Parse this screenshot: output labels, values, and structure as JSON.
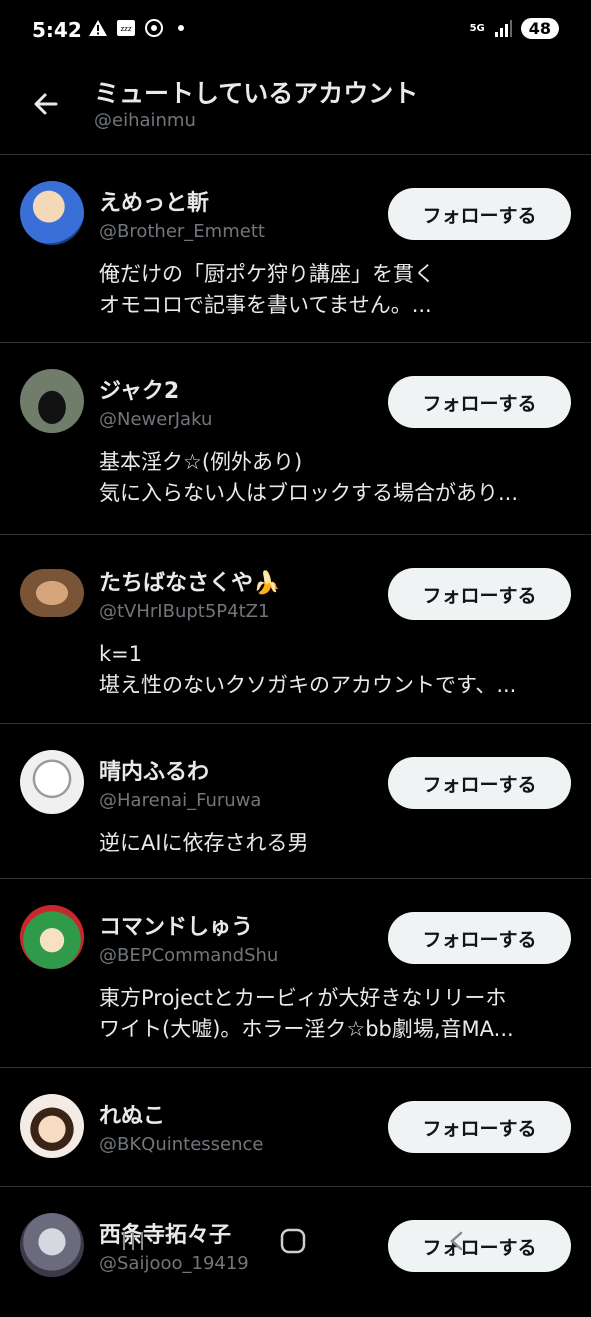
{
  "status_bar": {
    "time": "5:42",
    "network": "5G",
    "battery": "48",
    "icons": [
      "warning-icon",
      "zzz-icon",
      "data-saver-icon",
      "notification-dot-icon",
      "signal-icon"
    ]
  },
  "header": {
    "title": "ミュートしているアカウント",
    "subtitle": "@eihainmu",
    "back_icon": "arrow-left-icon"
  },
  "accounts": [
    {
      "name": "えめっと斬",
      "handle": "@Brother_Emmett",
      "bio": [
        "俺だけの「厨ポケ狩り講座」を貫く",
        "オモコロで記事を書いてません。..."
      ],
      "button": "フォローする",
      "avatar_color": "#3a6fd8"
    },
    {
      "name": "ジャク2",
      "handle": "@NewerJaku",
      "bio": [
        "基本淫ク☆(例外あり)",
        "気に入らない人はブロックする場合があり..."
      ],
      "button": "フォローする",
      "avatar_color": "#5e6b5a"
    },
    {
      "name": "たちばなさくや🍌",
      "handle": "@tVHrIBupt5P4tZ1",
      "bio": [
        "k=1",
        "堪え性のないクソガキのアカウントです、..."
      ],
      "button": "フォローする",
      "avatar_color": "#b5865e"
    },
    {
      "name": "晴内ふるわ",
      "handle": "@Harenai_Furuwa",
      "bio": [
        "逆にAIに依存される男"
      ],
      "button": "フォローする",
      "avatar_color": "#eeeeee"
    },
    {
      "name": "コマンドしゅう",
      "handle": "@BEPCommandShu",
      "bio": [
        "東方Projectとカービィが大好きなリリーホ",
        "ワイト(大嘘)。ホラー淫ク☆bb劇場,音MA..."
      ],
      "button": "フォローする",
      "avatar_color": "#2f9a4a"
    },
    {
      "name": "れぬこ",
      "handle": "@BKQuintessence",
      "bio": [],
      "button": "フォローする",
      "avatar_color": "#f2e6d8"
    },
    {
      "name": "西条寺拓々子",
      "handle": "@Saijooo_19419",
      "bio": [],
      "button": "フォローする",
      "avatar_color": "#8a8a9a"
    }
  ],
  "nav_bar": {
    "icons": [
      "recent-apps-icon",
      "home-icon",
      "back-icon"
    ]
  }
}
